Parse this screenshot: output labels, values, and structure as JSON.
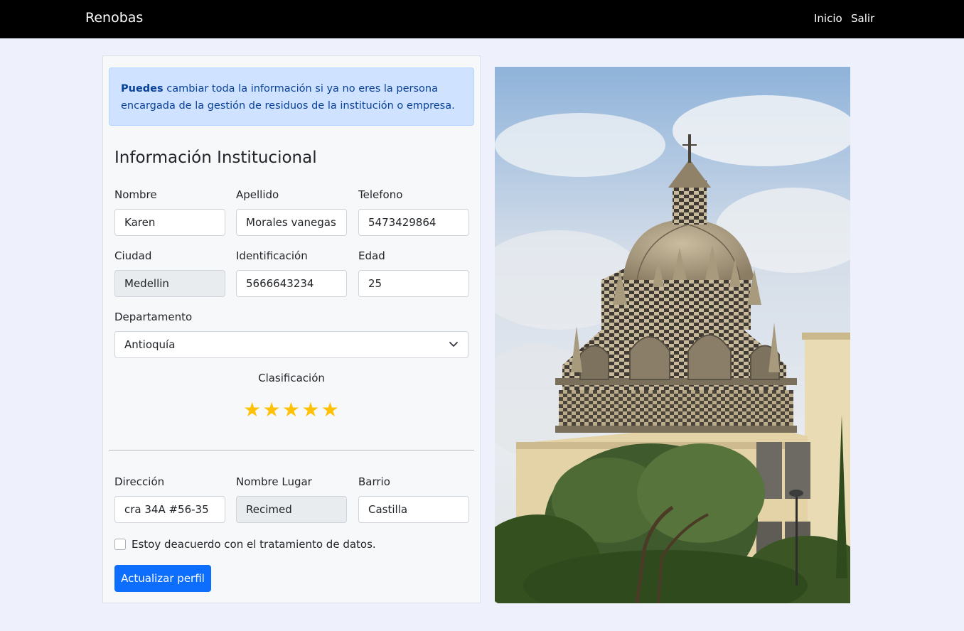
{
  "nav": {
    "brand": "Renobas",
    "links": [
      "Inicio",
      "Salir"
    ]
  },
  "alert": {
    "bold": "Puedes",
    "line1": " cambiar toda la información si ya no eres la persona",
    "line2": "encargada de la gestión de residuos de la institución o empresa."
  },
  "section_title": "Información Institucional",
  "fields": {
    "nombre": {
      "label": "Nombre",
      "value": "Karen"
    },
    "apellido": {
      "label": "Apellido",
      "value": "Morales vanegas"
    },
    "telefono": {
      "label": "Telefono",
      "value": "5473429864"
    },
    "ciudad": {
      "label": "Ciudad",
      "value": "Medellin",
      "disabled": true
    },
    "identificacion": {
      "label": "Identificación",
      "value": "5666643234"
    },
    "edad": {
      "label": "Edad",
      "value": "25"
    },
    "departamento": {
      "label": "Departamento",
      "value": "Antioquía"
    },
    "direccion": {
      "label": "Dirección",
      "value": "cra 34A #56-35"
    },
    "nombre_lugar": {
      "label": "Nombre Lugar",
      "value": "Recimed",
      "disabled": true
    },
    "barrio": {
      "label": "Barrio",
      "value": "Castilla"
    }
  },
  "rating": {
    "label": "Clasificación",
    "value": 5,
    "max": 5,
    "color": "#ffc107"
  },
  "checkbox": {
    "label": "Estoy deacuerdo con el tratamiento de datos.",
    "checked": false
  },
  "submit_label": "Actualizar perfil",
  "colors": {
    "navbar": "#000000",
    "page_bg": "#eef0fb",
    "alert_bg": "#cfe2ff",
    "alert_text": "#084298",
    "primary": "#0d6efd"
  }
}
